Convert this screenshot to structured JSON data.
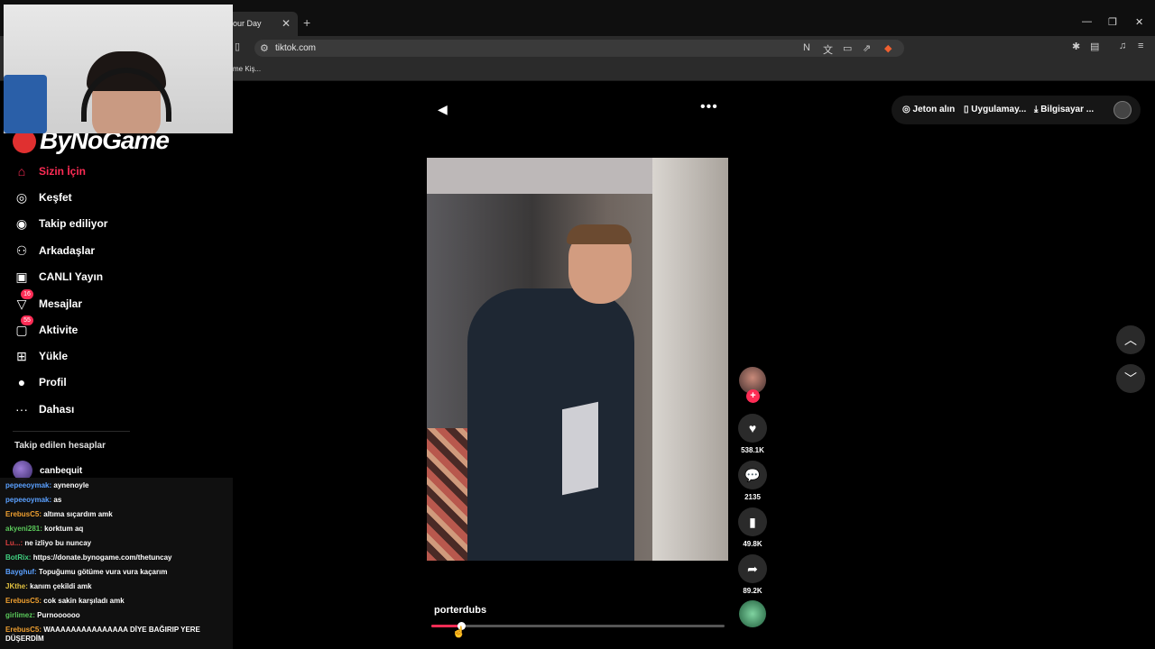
{
  "browser": {
    "tab_title": "our Day",
    "tab_close": "✕",
    "new_tab": "+",
    "url": "tiktok.com",
    "bookmark_text": "me Kiş...",
    "win_minimize": "—",
    "win_restore": "❐",
    "win_close": "✕"
  },
  "logo": {
    "text": "ByNoGame"
  },
  "sidebar": {
    "items": [
      {
        "label": "Sizin İçin",
        "icon": "home-icon",
        "glyph": "⌂"
      },
      {
        "label": "Keşfet",
        "icon": "compass-icon",
        "glyph": "◎"
      },
      {
        "label": "Takip ediliyor",
        "icon": "following-avatar-icon",
        "glyph": "◉"
      },
      {
        "label": "Arkadaşlar",
        "icon": "friends-icon",
        "glyph": "⚇"
      },
      {
        "label": "CANLI Yayın",
        "icon": "live-tv-icon",
        "glyph": "▣"
      },
      {
        "label": "Mesajlar",
        "icon": "messages-icon",
        "glyph": "▽",
        "badge": "16"
      },
      {
        "label": "Aktivite",
        "icon": "activity-icon",
        "glyph": "▢",
        "badge": "55"
      },
      {
        "label": "Yükle",
        "icon": "upload-icon",
        "glyph": "⊞"
      },
      {
        "label": "Profil",
        "icon": "profile-icon",
        "glyph": "●"
      },
      {
        "label": "Dahası",
        "icon": "more-icon",
        "glyph": "···"
      }
    ],
    "section_title": "Takip edilen hesaplar",
    "following": [
      {
        "name": "canbequit"
      }
    ]
  },
  "chat": [
    {
      "user": "pepeeoymak:",
      "text": "aynenoyle",
      "color": "#5aa0ff"
    },
    {
      "user": "pepeeoymak:",
      "text": "as",
      "color": "#5aa0ff"
    },
    {
      "user": "ErebusC5:",
      "text": "altıma sıçardım amk",
      "color": "#f0a030"
    },
    {
      "user": "akyeni281:",
      "text": "korktum aq",
      "color": "#5ac85a"
    },
    {
      "user": "Lu...:",
      "text": "ne izliyo bu nuncay",
      "color": "#e04040"
    },
    {
      "user": "BotRix:",
      "text": "https://donate.bynogame.com/thetuncay",
      "color": "#40d080"
    },
    {
      "user": "Bayghuf:",
      "text": "Topuğumu götüme vura vura kaçarım",
      "color": "#5aa0ff"
    },
    {
      "user": "JKthe:",
      "text": "kanım çekildi amk",
      "color": "#e0c040"
    },
    {
      "user": "ErebusC5:",
      "text": "cok sakin karşıladı amk",
      "color": "#f0a030"
    },
    {
      "user": "girlimez:",
      "text": "Purnoooooo",
      "color": "#5ac85a"
    },
    {
      "user": "ErebusC5:",
      "text": "WAAAAAAAAAAAAAAA DİYE BAĞIRIP YERE DÜŞERDİM",
      "color": "#f0a030"
    }
  ],
  "top_links": {
    "coins": "Jeton alın",
    "app": "Uygulamay...",
    "computer": "Bilgisayar ..."
  },
  "video": {
    "author": "porterdubs",
    "progress": 0.1,
    "likes": "538.1K",
    "comments": "2135",
    "saves": "49.8K",
    "shares": "89.2K"
  }
}
